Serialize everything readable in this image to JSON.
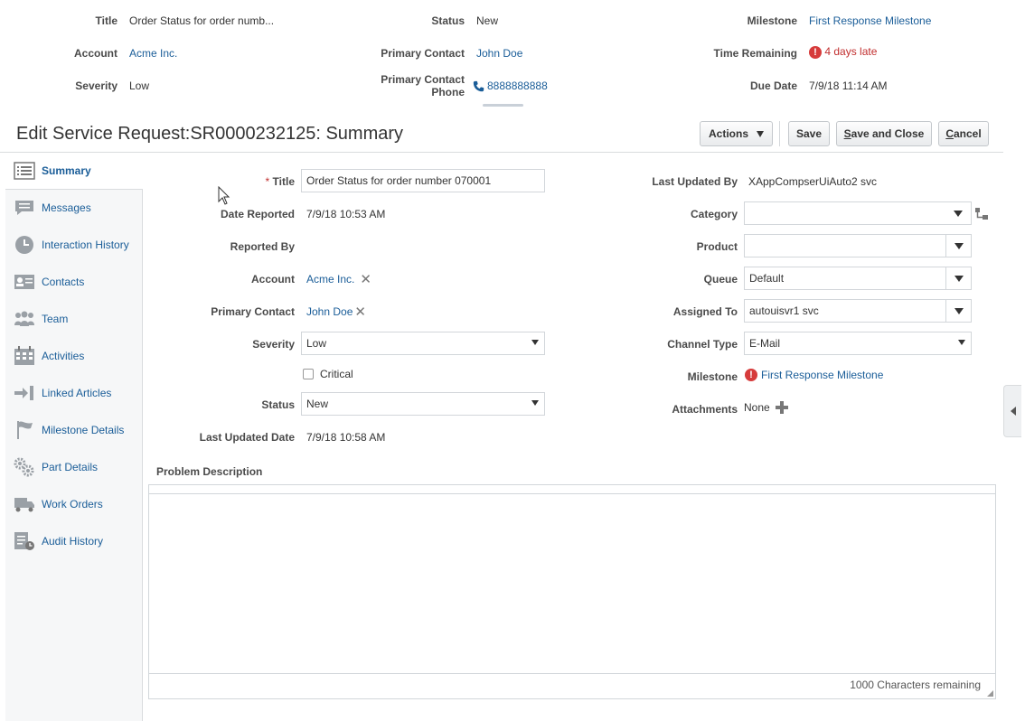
{
  "header": {
    "title_label": "Title",
    "title_value": "Order Status for order numb...",
    "account_label": "Account",
    "account_value": "Acme Inc.",
    "severity_label": "Severity",
    "severity_value": "Low",
    "status_label": "Status",
    "status_value": "New",
    "primary_contact_label": "Primary Contact",
    "primary_contact_value": "John Doe",
    "primary_contact_phone_label_1": "Primary Contact",
    "primary_contact_phone_label_2": "Phone",
    "primary_contact_phone_value": "8888888888",
    "milestone_label": "Milestone",
    "milestone_value": "First Response Milestone",
    "time_remaining_label": "Time Remaining",
    "time_remaining_value": "4 days late",
    "due_date_label": "Due Date",
    "due_date_value": "7/9/18 11:14 AM"
  },
  "page_title": "Edit Service Request:SR0000232125: Summary",
  "toolbar": {
    "actions_label": "Actions",
    "save_label": "Save",
    "save_close_first": "S",
    "save_close_rest": "ave and Close",
    "cancel_first": "C",
    "cancel_rest": "ancel"
  },
  "sidebar": {
    "items": [
      {
        "label": "Summary",
        "icon": "summary-icon"
      },
      {
        "label": "Messages",
        "icon": "messages-icon"
      },
      {
        "label": "Interaction History",
        "icon": "clock-icon"
      },
      {
        "label": "Contacts",
        "icon": "contact-card-icon"
      },
      {
        "label": "Team",
        "icon": "team-icon"
      },
      {
        "label": "Activities",
        "icon": "calendar-icon"
      },
      {
        "label": "Linked Articles",
        "icon": "link-arrow-icon"
      },
      {
        "label": "Milestone Details",
        "icon": "flag-icon"
      },
      {
        "label": "Part Details",
        "icon": "gears-icon"
      },
      {
        "label": "Work Orders",
        "icon": "truck-icon"
      },
      {
        "label": "Audit History",
        "icon": "audit-icon"
      }
    ]
  },
  "form_left": {
    "required_mark": "*",
    "title_label": "Title",
    "title_value": "Order Status for order number 070001",
    "date_reported_label": "Date Reported",
    "date_reported_value": "7/9/18 10:53 AM",
    "reported_by_label": "Reported By",
    "account_label": "Account",
    "account_value": "Acme Inc.",
    "primary_contact_label": "Primary Contact",
    "primary_contact_value": "John Doe",
    "severity_label": "Severity",
    "severity_value": "Low",
    "critical_label": "Critical",
    "status_label": "Status",
    "status_value": "New",
    "last_updated_date_label": "Last Updated Date",
    "last_updated_date_value": "7/9/18 10:58 AM"
  },
  "form_right": {
    "last_updated_by_label": "Last Updated By",
    "last_updated_by_value": "XAppCompserUiAuto2 svc",
    "category_label": "Category",
    "category_value": "",
    "product_label": "Product",
    "product_value": "",
    "queue_label": "Queue",
    "queue_value": "Default",
    "assigned_to_label": "Assigned To",
    "assigned_to_value": "autouisvr1 svc",
    "channel_type_label": "Channel Type",
    "channel_type_value": "E-Mail",
    "milestone_label": "Milestone",
    "milestone_value": "First Response Milestone",
    "attachments_label": "Attachments",
    "attachments_value": "None"
  },
  "problem": {
    "label": "Problem Description",
    "chars_remaining": "1000 Characters remaining"
  },
  "colors": {
    "link": "#1a5d98",
    "late": "#c12e2e",
    "sidebar_bg": "#f6f7f8"
  }
}
